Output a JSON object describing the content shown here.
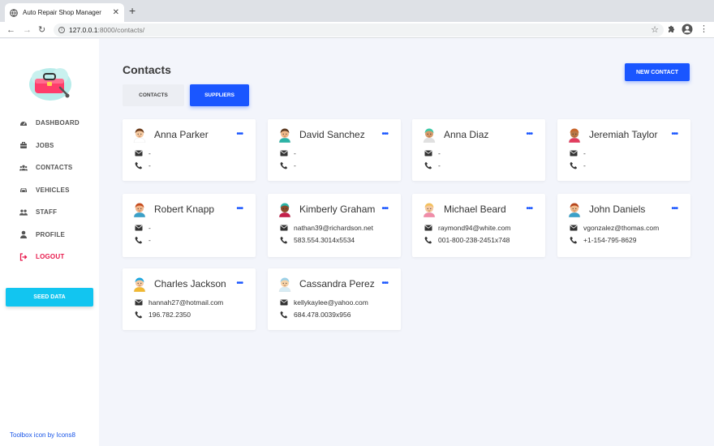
{
  "browser": {
    "tab_title": "Auto Repair Shop Manager",
    "url_host": "127.0.0.1",
    "url_rest": ":8000/contacts/"
  },
  "sidebar": {
    "items": [
      {
        "label": "DASHBOARD",
        "icon": "dashboard-icon"
      },
      {
        "label": "JOBS",
        "icon": "briefcase-icon"
      },
      {
        "label": "CONTACTS",
        "icon": "users-icon"
      },
      {
        "label": "VEHICLES",
        "icon": "car-icon"
      },
      {
        "label": "STAFF",
        "icon": "staff-icon"
      },
      {
        "label": "PROFILE",
        "icon": "user-icon"
      },
      {
        "label": "LOGOUT",
        "icon": "logout-icon"
      }
    ],
    "seed_label": "SEED DATA",
    "credit": "Toolbox icon by Icons8"
  },
  "main": {
    "title": "Contacts",
    "new_contact_label": "NEW CONTACT",
    "tabs": [
      {
        "label": "CONTACTS"
      },
      {
        "label": "SUPPLIERS"
      }
    ],
    "contacts": [
      {
        "name": "Anna Parker",
        "email": "-",
        "phone": "-"
      },
      {
        "name": "David Sanchez",
        "email": "-",
        "phone": "-"
      },
      {
        "name": "Anna Diaz",
        "email": "-",
        "phone": "-"
      },
      {
        "name": "Jeremiah Taylor",
        "email": "-",
        "phone": "-"
      },
      {
        "name": "Robert Knapp",
        "email": "-",
        "phone": "-"
      },
      {
        "name": "Kimberly Graham",
        "email": "nathan39@richardson.net",
        "phone": "583.554.3014x5534"
      },
      {
        "name": "Michael Beard",
        "email": "raymond94@white.com",
        "phone": "001-800-238-2451x748"
      },
      {
        "name": "John Daniels",
        "email": "vgonzalez@thomas.com",
        "phone": "+1-154-795-8629"
      },
      {
        "name": "Charles Jackson",
        "email": "hannah27@hotmail.com",
        "phone": "196.782.2350"
      },
      {
        "name": "Cassandra Perez",
        "email": "kellykaylee@yahoo.com",
        "phone": "684.478.0039x956"
      }
    ]
  },
  "colors": {
    "accent": "#1a56ff",
    "seed": "#12c5f0",
    "logout": "#e8174a"
  }
}
